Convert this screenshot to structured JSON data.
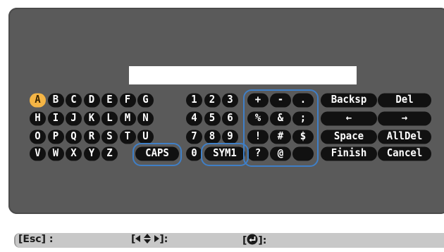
{
  "keyboard": {
    "letters": [
      [
        "A",
        "B",
        "C",
        "D",
        "E",
        "F",
        "G"
      ],
      [
        "H",
        "I",
        "J",
        "K",
        "L",
        "M",
        "N"
      ],
      [
        "O",
        "P",
        "Q",
        "R",
        "S",
        "T",
        "U"
      ],
      [
        "V",
        "W",
        "X",
        "Y",
        "Z"
      ]
    ],
    "caps_label": "CAPS",
    "digits": [
      [
        "1",
        "2",
        "3"
      ],
      [
        "4",
        "5",
        "6"
      ],
      [
        "7",
        "8",
        "9"
      ],
      [
        "0"
      ]
    ],
    "sym1_label": "SYM1",
    "symbols": [
      [
        "+",
        "-",
        "."
      ],
      [
        "%",
        "&",
        ";"
      ],
      [
        "!",
        "#",
        "$"
      ],
      [
        "?",
        "@",
        ""
      ]
    ],
    "functions": [
      [
        "Backsp",
        "Del"
      ],
      [
        "←",
        "→"
      ],
      [
        "Space",
        "AllDel"
      ],
      [
        "Finish",
        "Cancel"
      ]
    ],
    "selected_key": "A"
  },
  "input": {
    "value": ""
  },
  "help_bar": {
    "esc_label": "[Esc] :",
    "arrows_prefix": "[",
    "arrows_suffix": "]:",
    "enter_prefix": "[",
    "enter_suffix": "]:"
  }
}
